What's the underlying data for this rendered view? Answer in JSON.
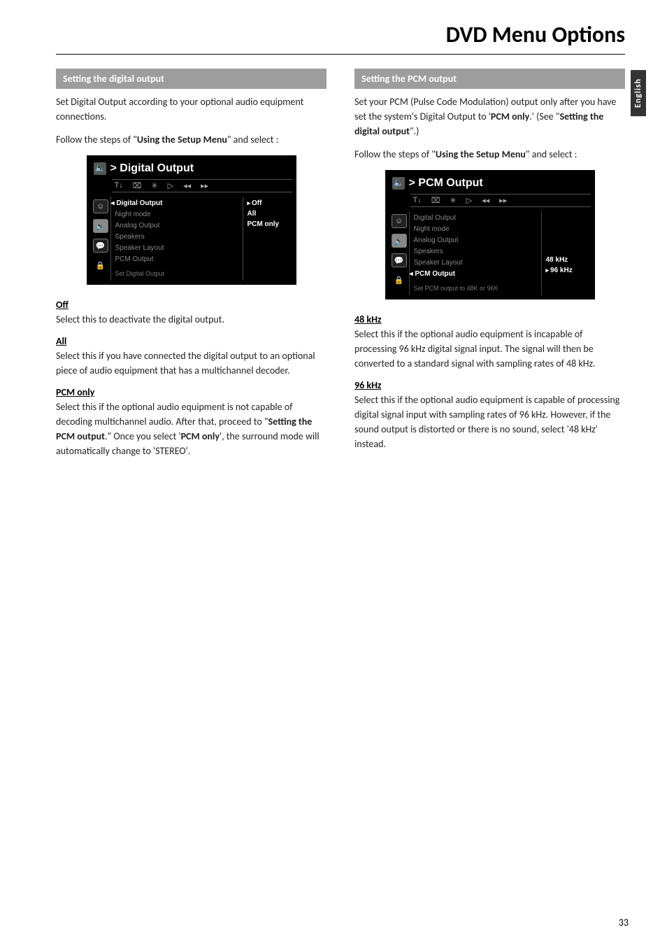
{
  "page": {
    "title": "DVD Menu Options",
    "language_tab": "English",
    "page_number": "33"
  },
  "left": {
    "header": "Setting the digital output",
    "p1a": "Set Digital Output according to your optional audio equipment connections.",
    "p2a": "Follow the steps of \"",
    "p2b": "Using the Setup Menu",
    "p2c": "\" and select :",
    "osd": {
      "title": "> Digital Output",
      "items": [
        "Digital Output",
        "Night mode",
        "Analog Output",
        "Speakers",
        "Speaker Layout",
        "PCM Output"
      ],
      "selected_index": 0,
      "options": [
        "Off",
        "All",
        "PCM only"
      ],
      "option_selected_index": 0,
      "help": "Set  Digital  Output"
    },
    "off_h": "Off",
    "off_p": "Select this to deactivate the digital output.",
    "all_h": "All",
    "all_p": "Select this if you have connected the digital output to an optional piece of audio equipment that has a multichannel decoder.",
    "pcm_h": "PCM only",
    "pcm_p1a": "Select this if the optional audio equipment is not capable of decoding multichannel audio.  After that, proceed to \"",
    "pcm_p1b": "Setting the PCM output",
    "pcm_p1c": ".\" Once you select '",
    "pcm_p1d": "PCM only",
    "pcm_p1e": "', the surround mode will automatically change to 'STEREO'."
  },
  "right": {
    "header": "Setting the PCM output",
    "p1a": "Set your PCM (Pulse Code Modulation) output only after you have set the system's Digital Output to '",
    "p1b": "PCM only",
    "p1c": ".'  (See \"",
    "p1d": "Setting the digital output",
    "p1e": "\".)",
    "p2a": "Follow the steps of \"",
    "p2b": "Using the Setup Menu",
    "p2c": "\" and select :",
    "osd": {
      "title": "> PCM Output",
      "items": [
        "Digital Output",
        "Night mode",
        "Analog Output",
        "Speakers",
        "Speaker Layout",
        "PCM Output"
      ],
      "selected_index": 5,
      "options": [
        "48 kHz",
        "96 kHz"
      ],
      "option_selected_index": 1,
      "help": "Set  PCM  output  to  48K  or  96K"
    },
    "k48_h": "48 kHz",
    "k48_p": "Select this if the optional audio equipment is incapable of processing 96 kHz digital signal input.  The signal will then be converted to a standard signal with sampling rates of 48 kHz.",
    "k96_h": "96 kHz",
    "k96_p": "Select this if the optional audio equipment is capable of processing digital signal input with sampling rates of 96 kHz.  However, if the sound output is distorted or there is no sound, select '48 kHz' instead."
  }
}
